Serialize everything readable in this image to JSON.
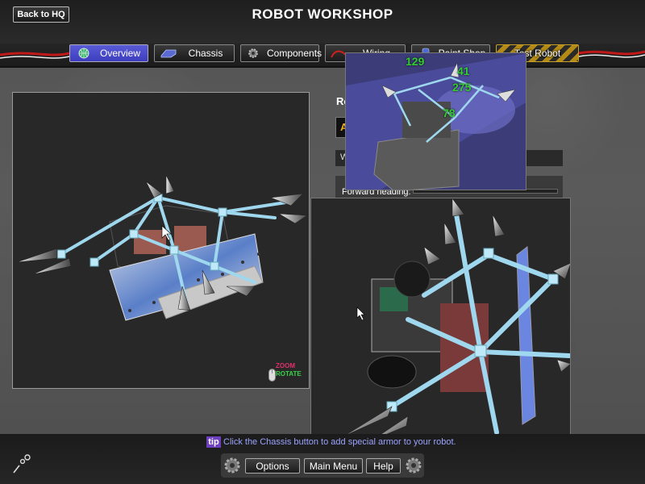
{
  "header": {
    "back_label": "Back to HQ",
    "title": "ROBOT WORKSHOP"
  },
  "tabs": [
    {
      "label": "Overview",
      "icon": "globe-icon",
      "selected": true
    },
    {
      "label": "Chassis",
      "icon": "chassis-icon",
      "selected": false
    },
    {
      "label": "Components",
      "icon": "gear-icon",
      "selected": false
    },
    {
      "label": "Wiring",
      "icon": "wiring-icon",
      "selected": false
    },
    {
      "label": "Paint Shop",
      "icon": "paint-icon",
      "selected": false
    },
    {
      "label": "Test Robot",
      "icon": "hazard-stripes",
      "selected": false
    }
  ],
  "right_panel": {
    "title_partial": "Ro",
    "name_partial": "A",
    "row1_partial": "W",
    "heading_label": "Forward heading:"
  },
  "viewport_main": {
    "zoom_label": "ZOOM",
    "rotate_label": "ROTATE",
    "zoom_color": "#e0306a",
    "rotate_color": "#3ad24a"
  },
  "viewport_top": {
    "stats": [
      "129",
      "41",
      "275",
      "78"
    ],
    "stat_color": "#33cc33"
  },
  "tip": {
    "badge": "tip",
    "text": "Click the Chassis button to add special armor to your robot."
  },
  "bottom_menu": {
    "options_label": "Options",
    "main_menu_label": "Main Menu",
    "help_label": "Help"
  },
  "colors": {
    "accent_tab": "#4b4cd0",
    "frame_cyan": "#9fd8ee",
    "wire_red": "#c01818"
  }
}
